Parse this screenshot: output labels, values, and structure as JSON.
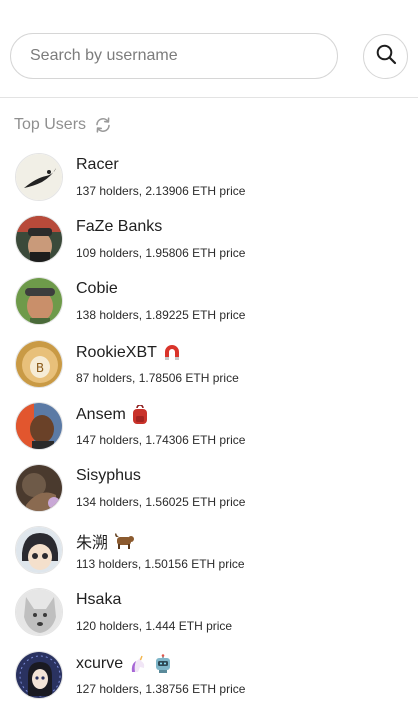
{
  "search": {
    "placeholder": "Search by username",
    "value": "",
    "icon": "search-icon"
  },
  "section": {
    "title": "Top Users",
    "refresh_icon": "refresh-icon"
  },
  "users": [
    {
      "name": "Racer",
      "stats": "137 holders, 2.13906 ETH price",
      "avatar": "racer-avatar",
      "badges": []
    },
    {
      "name": "FaZe Banks",
      "stats": "109 holders, 1.95806 ETH price",
      "avatar": "faze-banks-avatar",
      "badges": []
    },
    {
      "name": "Cobie",
      "stats": "138 holders, 1.89225 ETH price",
      "avatar": "cobie-avatar",
      "badges": []
    },
    {
      "name": "RookieXBT",
      "stats": "87 holders, 1.78506 ETH price",
      "avatar": "rookiexbt-avatar",
      "badges": [
        "magnet-icon"
      ]
    },
    {
      "name": "Ansem",
      "stats": "147 holders, 1.74306 ETH price",
      "avatar": "ansem-avatar",
      "badges": [
        "backpack-icon"
      ]
    },
    {
      "name": "Sisyphus",
      "stats": "134 holders, 1.56025 ETH price",
      "avatar": "sisyphus-avatar",
      "badges": []
    },
    {
      "name": "朱溯",
      "stats": "113 holders, 1.50156 ETH price",
      "avatar": "zhu-su-avatar",
      "badges": [
        "ox-icon"
      ]
    },
    {
      "name": "Hsaka",
      "stats": "120 holders, 1.444 ETH price",
      "avatar": "hsaka-avatar",
      "badges": []
    },
    {
      "name": "xcurve",
      "stats": "127 holders, 1.38756 ETH price",
      "avatar": "xcurve-avatar",
      "badges": [
        "unicorn-icon",
        "robot-icon"
      ]
    }
  ]
}
